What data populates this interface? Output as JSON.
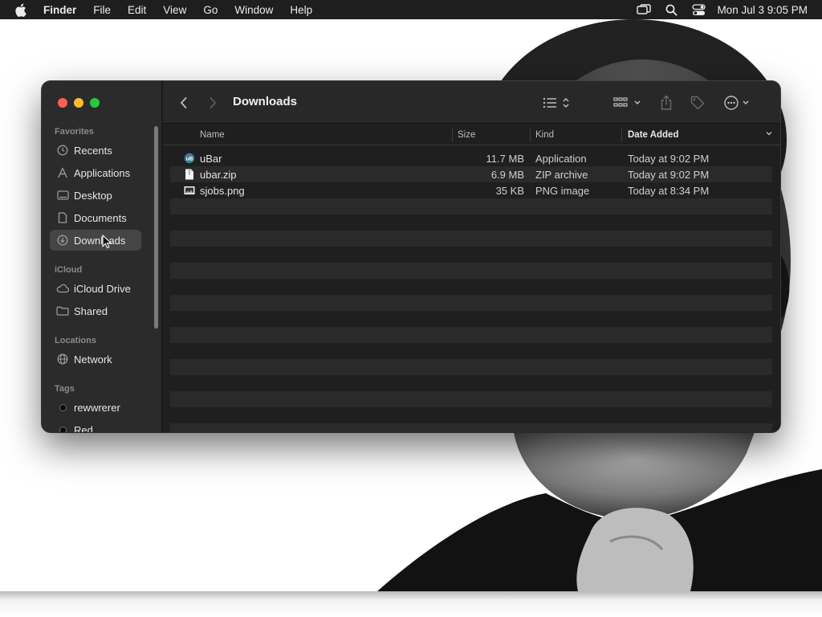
{
  "menubar": {
    "app_name": "Finder",
    "menus": [
      "File",
      "Edit",
      "View",
      "Go",
      "Window",
      "Help"
    ],
    "clock": "Mon Jul 3  9:05 PM"
  },
  "window": {
    "title": "Downloads"
  },
  "sidebar": {
    "favorites_label": "Favorites",
    "favorites": [
      {
        "label": "Recents",
        "icon": "clock-icon"
      },
      {
        "label": "Applications",
        "icon": "applications-icon"
      },
      {
        "label": "Desktop",
        "icon": "desktop-icon"
      },
      {
        "label": "Documents",
        "icon": "document-icon"
      },
      {
        "label": "Downloads",
        "icon": "download-icon",
        "selected": true
      }
    ],
    "icloud_label": "iCloud",
    "icloud": [
      {
        "label": "iCloud Drive",
        "icon": "cloud-icon"
      },
      {
        "label": "Shared",
        "icon": "shared-folder-icon"
      }
    ],
    "locations_label": "Locations",
    "locations": [
      {
        "label": "Network",
        "icon": "globe-icon"
      }
    ],
    "tags_label": "Tags",
    "tags": [
      {
        "label": "rewwrerer",
        "color": "#000000"
      },
      {
        "label": "Red",
        "color": "#000000"
      }
    ]
  },
  "columns": {
    "name": "Name",
    "size": "Size",
    "kind": "Kind",
    "date_added": "Date Added"
  },
  "files": [
    {
      "name": "uBar",
      "size": "11.7 MB",
      "kind": "Application",
      "date_added": "Today at 9:02 PM",
      "icon": "app-icon"
    },
    {
      "name": "ubar.zip",
      "size": "6.9 MB",
      "kind": "ZIP archive",
      "date_added": "Today at 9:02 PM",
      "icon": "zip-file-icon"
    },
    {
      "name": "sjobs.png",
      "size": "35 KB",
      "kind": "PNG image",
      "date_added": "Today at 8:34 PM",
      "icon": "image-file-icon"
    }
  ],
  "colors": {
    "close": "#ff5f57",
    "minimize": "#febc2e",
    "maximize": "#28c840",
    "window_bg": "#1f1f1f",
    "sidebar_bg": "#2b2b2b"
  }
}
